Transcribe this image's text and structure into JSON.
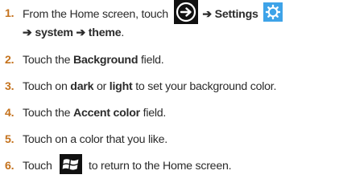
{
  "steps": [
    {
      "num": "1.",
      "pre": "From the Home screen, touch",
      "arrow_icon": "circle-right-arrow-icon",
      "arrow1": "➔",
      "settings": "Settings",
      "settings_icon": "settings-gear-icon",
      "line2_arrow_a": "➔",
      "system": "system",
      "line2_arrow_b": "➔",
      "theme": "theme",
      "end": "."
    },
    {
      "num": "2.",
      "pre": "Touch the",
      "bold": "Background",
      "post": "field."
    },
    {
      "num": "3.",
      "pre": "Touch on",
      "bold1": "dark",
      "mid": "or",
      "bold2": "light",
      "post": "to set your background color."
    },
    {
      "num": "4.",
      "pre": "Touch the",
      "bold": "Accent color",
      "post": "field."
    },
    {
      "num": "5.",
      "text": "Touch on a color that you like."
    },
    {
      "num": "6.",
      "pre": "Touch",
      "win_icon": "windows-start-icon",
      "post": "to return to the Home screen."
    }
  ],
  "colors": {
    "number": "#c4721d",
    "text": "#2b2b2b",
    "gear_bg": "#3ea3e8"
  }
}
